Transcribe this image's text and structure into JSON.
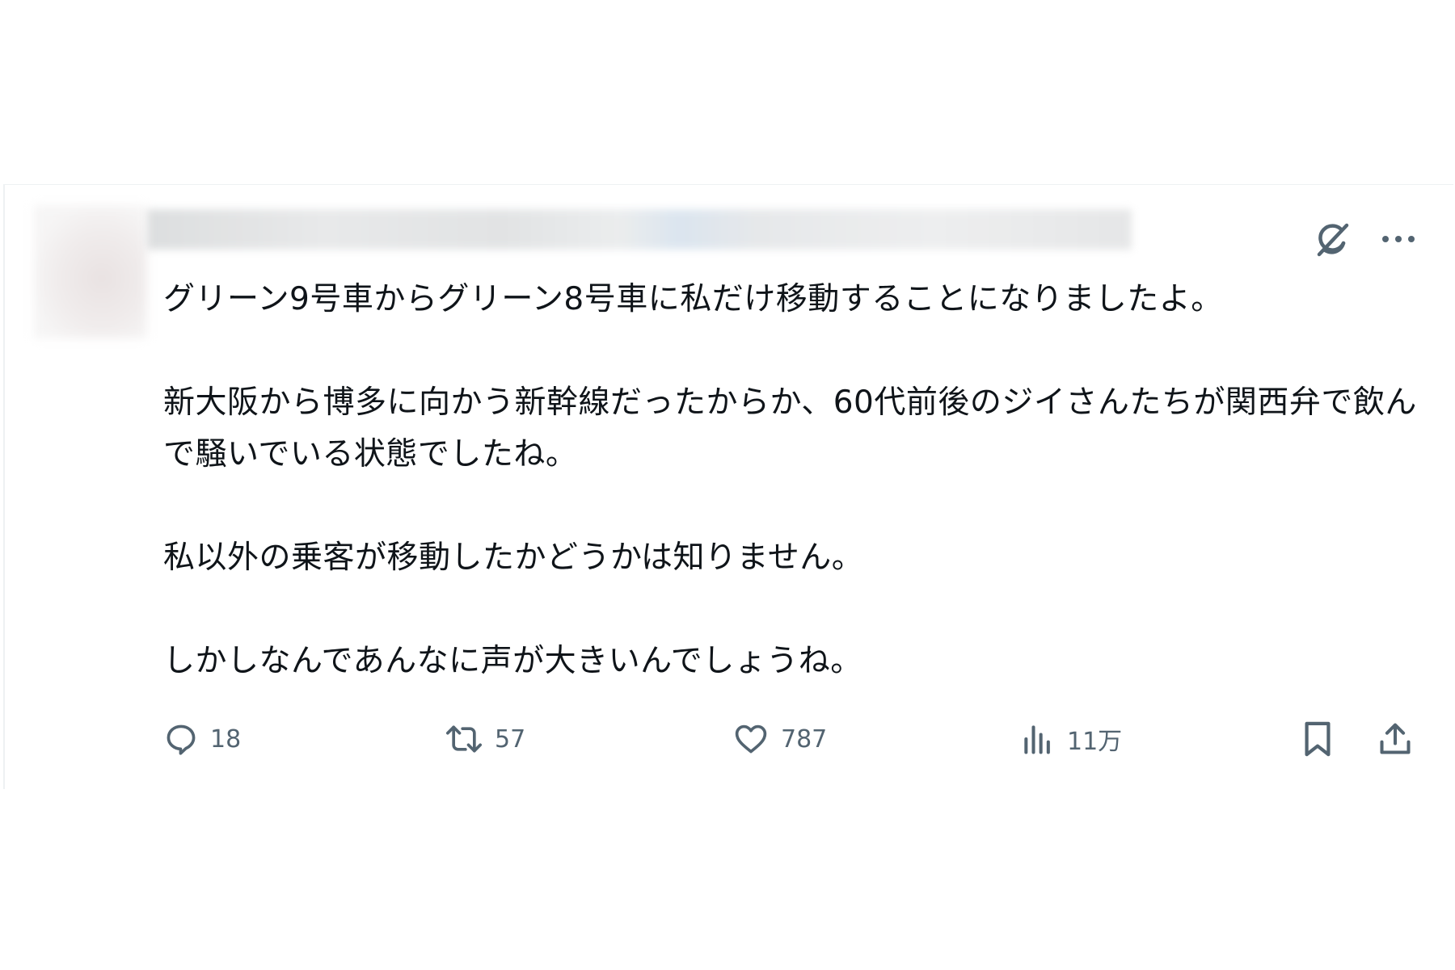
{
  "post": {
    "paragraphs": [
      "グリーン9号車からグリーン8号車に私だけ移動することになりましたよ。",
      "新大阪から博多に向かう新幹線だったからか、60代前後のジイさんたちが関西弁で飲んで騒いでいる状態でしたね。",
      "私以外の乗客が移動したかどうかは知りません。",
      "しかしなんであんなに声が大きいんでしょうね。"
    ]
  },
  "header": {
    "icons": [
      "grok-icon",
      "more-icon"
    ]
  },
  "actions": {
    "reply_count": "18",
    "repost_count": "57",
    "like_count": "787",
    "views_count": "11万",
    "icons": [
      "reply-icon",
      "repost-icon",
      "like-icon",
      "views-icon",
      "bookmark-icon",
      "share-icon"
    ]
  },
  "colors": {
    "text": "#0f1419",
    "icon": "#536471",
    "border": "#eef1f3"
  }
}
